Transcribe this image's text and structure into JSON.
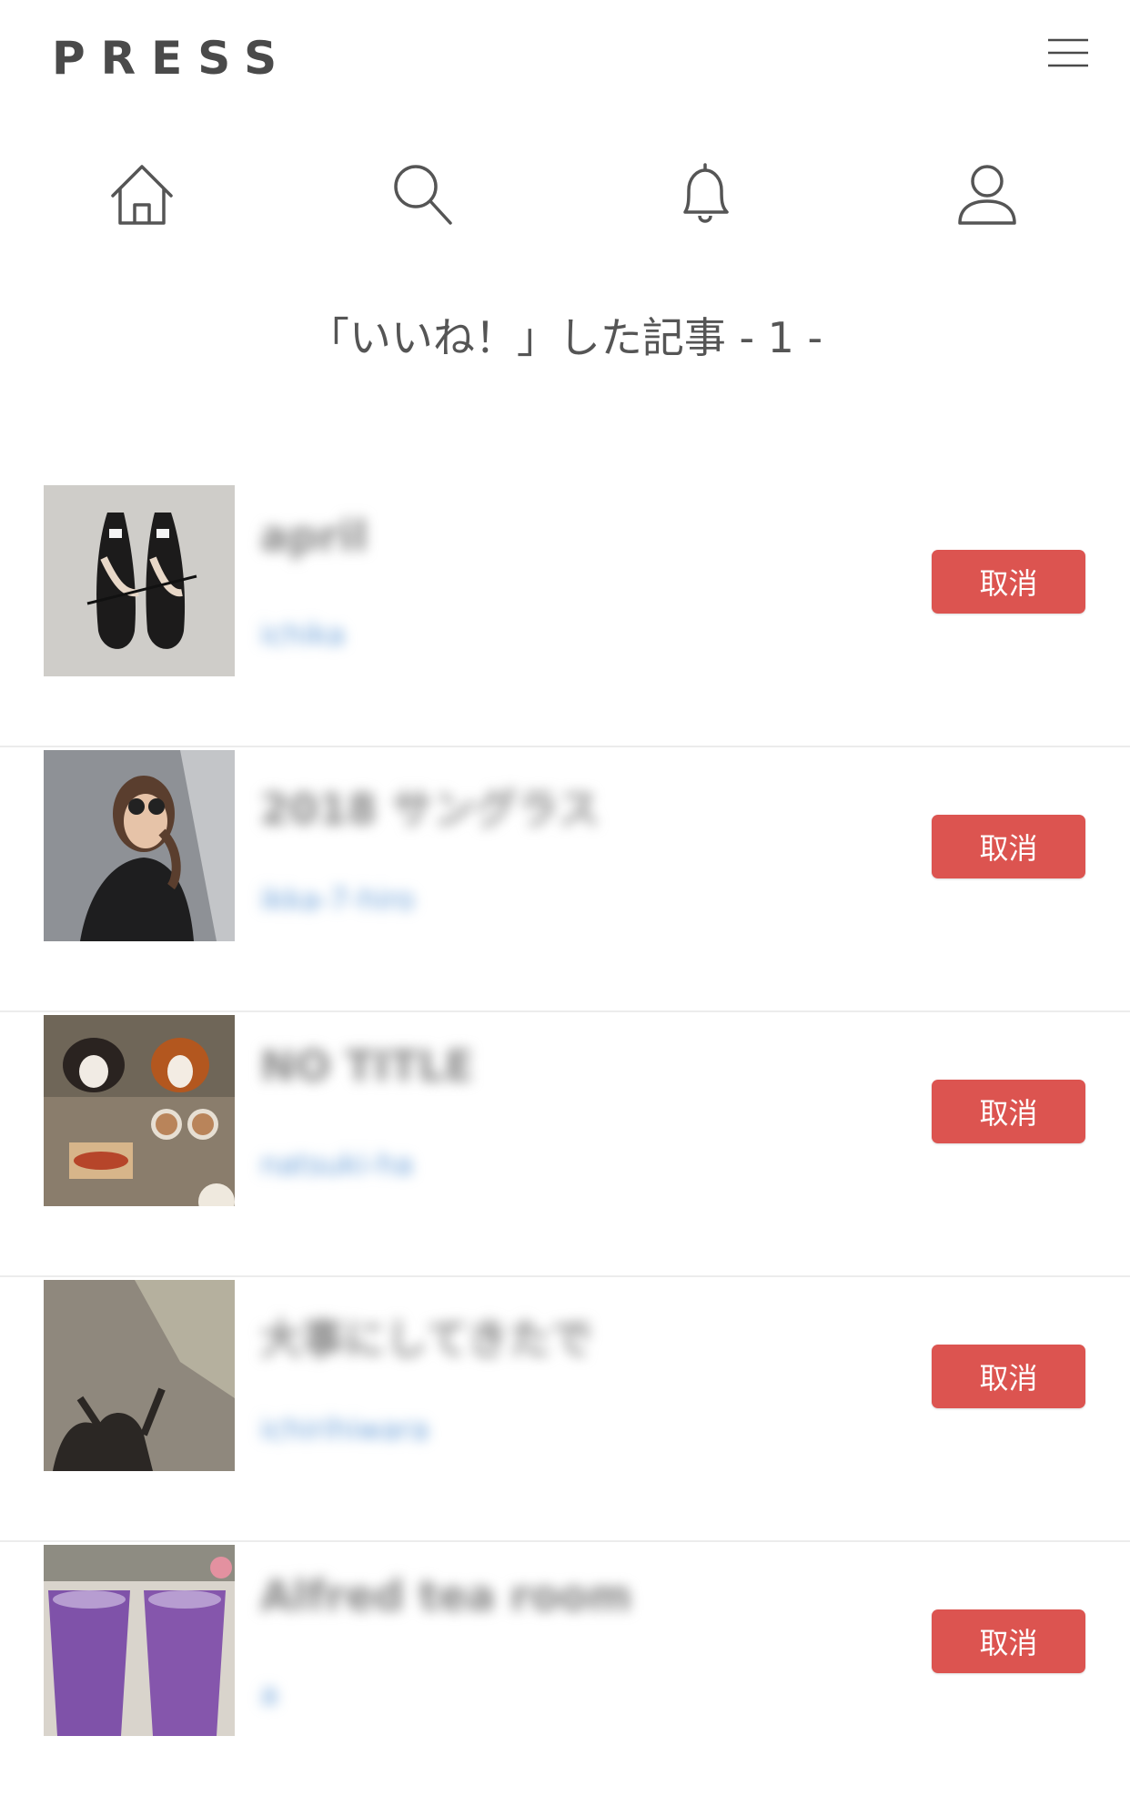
{
  "header": {
    "logo": "PRESS",
    "menu_icon": "hamburger-icon"
  },
  "nav": {
    "items": [
      {
        "icon": "home-icon"
      },
      {
        "icon": "search-icon"
      },
      {
        "icon": "bell-icon"
      },
      {
        "icon": "user-icon"
      }
    ]
  },
  "page_title": "「いいね！」した記事 - 1 -",
  "articles": [
    {
      "title": "april",
      "author": "ichika",
      "cancel_label": "取消",
      "thumb": "black-shoes-photo"
    },
    {
      "title": "2018 サングラス",
      "author": "ikka-7-hiro",
      "cancel_label": "取消",
      "thumb": "woman-sunglasses-photo"
    },
    {
      "title": "NO TITLE",
      "author": "natsuki-ha",
      "cancel_label": "取消",
      "thumb": "dogs-cafe-photo"
    },
    {
      "title": "大事にしてきたで",
      "author": "ichirihiwara",
      "cancel_label": "取消",
      "thumb": "shadow-wall-photo"
    },
    {
      "title": "Alfred tea room",
      "author": "a",
      "cancel_label": "取消",
      "thumb": "purple-drinks-photo"
    }
  ],
  "colors": {
    "accent": "#dc5450",
    "text": "#4a4a4a",
    "divider": "#ececec"
  }
}
